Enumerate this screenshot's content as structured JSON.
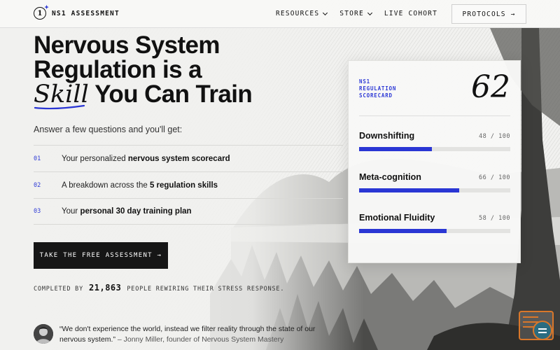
{
  "nav": {
    "logo_mark": "1",
    "logo_text": "NS1 ASSESSMENT",
    "links": [
      {
        "label": "RESOURCES",
        "dropdown": true
      },
      {
        "label": "STORE",
        "dropdown": true
      },
      {
        "label": "LIVE COHORT",
        "dropdown": false
      }
    ],
    "cta_label": "PROTOCOLS →"
  },
  "hero": {
    "title_line1": "Nervous System",
    "title_line2": "Regulation is a",
    "title_skill": "Skill",
    "title_line3_rest": " You Can Train",
    "subtitle": "Answer a few questions and you'll get:",
    "benefits": [
      {
        "num": "01",
        "pre": "Your personalized ",
        "bold": "nervous system scorecard",
        "post": ""
      },
      {
        "num": "02",
        "pre": "A breakdown across the ",
        "bold": "5 regulation skills",
        "post": ""
      },
      {
        "num": "03",
        "pre": "Your ",
        "bold": "personal 30 day training plan",
        "post": ""
      }
    ],
    "cta_label": "TAKE THE FREE ASSESSMENT →",
    "social_proof_pre": "COMPLETED BY",
    "social_proof_count": "21,863",
    "social_proof_post": "PEOPLE REWIRING THEIR STRESS RESPONSE."
  },
  "quote": {
    "text": "“We don't experience the world, instead we filter reality through the state of our nervous system.”",
    "author": " – Jonny Miller, founder of Nervous System Mastery"
  },
  "scorecard": {
    "label_lines": [
      "NS1",
      "REGULATION",
      "SCORECARD"
    ],
    "score": "62",
    "metrics": [
      {
        "name": "Downshifting",
        "value_text": "48 / 100",
        "value": 48,
        "max": 100
      },
      {
        "name": "Meta-cognition",
        "value_text": "66 / 100",
        "value": 66,
        "max": 100
      },
      {
        "name": "Emotional Fluidity",
        "value_text": "58 / 100",
        "value": 58,
        "max": 100
      }
    ]
  },
  "colors": {
    "accent": "#2a36d4",
    "dark": "#161616",
    "widget": "#d9772a"
  },
  "icons": {
    "nav_dropdown": "chevron-down-icon",
    "widget": "chat-widget-icon"
  }
}
